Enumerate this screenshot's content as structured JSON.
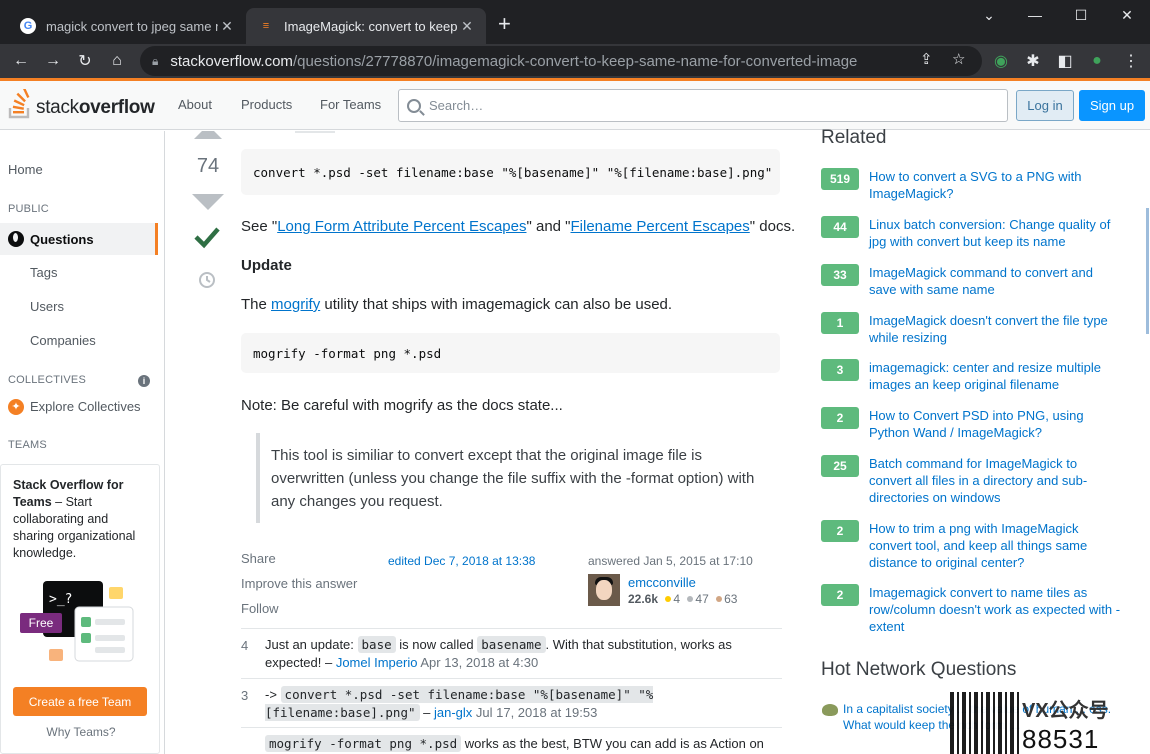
{
  "browser": {
    "tabs": [
      {
        "title": "magick convert to jpeg same n",
        "favicon": "google-icon"
      },
      {
        "title": "ImageMagick: convert to keep",
        "favicon": "stackoverflow-icon"
      }
    ],
    "url_domain": "stackoverflow.com",
    "url_path": "/questions/27778870/imagemagick-convert-to-keep-same-name-for-converted-image"
  },
  "header": {
    "logo_plain": "stack",
    "logo_bold": "overflow",
    "nav": [
      "About",
      "Products",
      "For Teams"
    ],
    "search_placeholder": "Search…",
    "login": "Log in",
    "signup": "Sign up"
  },
  "sidebar": {
    "home": "Home",
    "public": "PUBLIC",
    "questions": "Questions",
    "tags": "Tags",
    "users": "Users",
    "companies": "Companies",
    "collectives": "COLLECTIVES",
    "explore": "Explore Collectives",
    "teams": "TEAMS",
    "teams_box": {
      "title": "Stack Overflow for Teams",
      "text": " – Start collaborating and sharing organizational knowledge.",
      "free": "Free",
      "create": "Create a free Team",
      "why": "Why Teams?"
    }
  },
  "answer": {
    "score": "74",
    "code1": "convert *.psd -set filename:base \"%[basename]\" \"%[filename:base].png\"",
    "see_prefix": "See \"",
    "link1": "Long Form Attribute Percent Escapes",
    "see_mid": "\" and \"",
    "link2": "Filename Percent Escapes",
    "see_suffix": "\" docs.",
    "update_heading": "Update",
    "mogrify_prefix": "The ",
    "mogrify_link": "mogrify",
    "mogrify_suffix": " utility that ships with imagemagick can also be used.",
    "code2": "mogrify -format png *.psd",
    "note": "Note: Be careful with mogrify as the docs state...",
    "quote": "This tool is similiar to convert except that the original image file is overwritten (unless you change the file suffix with the -format option) with any changes you request.",
    "share": "Share",
    "improve": "Improve this answer",
    "follow": "Follow",
    "edited": "edited Dec 7, 2018 at 13:38",
    "answered": "answered Jan 5, 2015 at 17:10",
    "user": "emcconville",
    "rep": "22.6k",
    "gold": "4",
    "silver": "47",
    "bronze": "63",
    "badge_colors": {
      "gold": "#ffcc01",
      "silver": "#b4b8bc",
      "bronze": "#d1a684"
    }
  },
  "comments": [
    {
      "score": "4",
      "pre": "Just an update: ",
      "code_a": "base",
      "mid": " is now called ",
      "code_b": "basename",
      "post": ". With that substitution, works as expected! – ",
      "user": "Jomel Imperio",
      "date": " Apr 13, 2018 at 4:30"
    },
    {
      "score": "3",
      "pre": "-> ",
      "code_a": "convert *.psd -set filename:base \"%[basename]\" \"%[filename:base].png\"",
      "post": " – ",
      "user": "jan-glx",
      "date": " Jul 17, 2018 at 19:53"
    },
    {
      "code_a": "mogrify -format png *.psd",
      "post": " works as the best, BTW you can add is as Action on"
    }
  ],
  "related": {
    "heading": "Related",
    "items": [
      {
        "score": "519",
        "title": "How to convert a SVG to a PNG with ImageMagick?"
      },
      {
        "score": "44",
        "title": "Linux batch conversion: Change quality of jpg with convert but keep its name"
      },
      {
        "score": "33",
        "title": "ImageMagick command to convert and save with same name"
      },
      {
        "score": "1",
        "title": "ImageMagick doesn't convert the file type while resizing"
      },
      {
        "score": "3",
        "title": "imagemagick: center and resize multiple images an keep original filename"
      },
      {
        "score": "2",
        "title": "How to Convert PSD into PNG, using Python Wand / ImageMagick?"
      },
      {
        "score": "25",
        "title": "Batch command for ImageMagick to convert all files in a directory and sub-directories on windows"
      },
      {
        "score": "2",
        "title": "How to trim a png with ImageMagick convert tool, and keep all things same distance to original center?"
      },
      {
        "score": "2",
        "title": "Imagemagick convert to name tiles as row/column doesn't work as expected with -extent"
      }
    ]
  },
  "hot": {
    "heading": "Hot Network Questions",
    "item": "In a capitalist society ... the value of human ... ess. What would keep the rich form j..."
  },
  "watermark": {
    "a": "VX公众号",
    "b": "88531"
  }
}
